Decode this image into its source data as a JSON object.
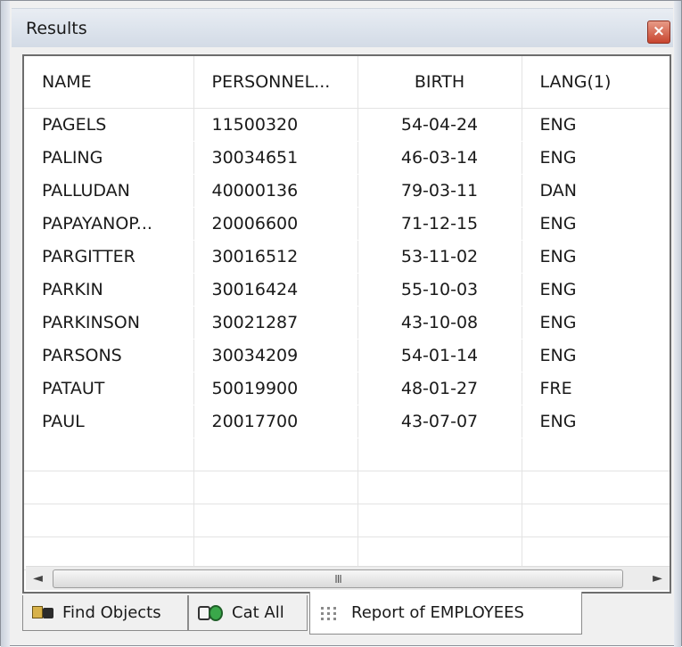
{
  "window": {
    "title": "Results",
    "close_glyph": "×"
  },
  "table": {
    "columns": [
      "NAME",
      "PERSONNEL...",
      "BIRTH",
      "LANG(1)"
    ],
    "rows": [
      [
        "PAGELS",
        "11500320",
        "54-04-24",
        "ENG"
      ],
      [
        "PALING",
        "30034651",
        "46-03-14",
        "ENG"
      ],
      [
        "PALLUDAN",
        "40000136",
        "79-03-11",
        "DAN"
      ],
      [
        "PAPAYANOP...",
        "20006600",
        "71-12-15",
        "ENG"
      ],
      [
        "PARGITTER",
        "30016512",
        "53-11-02",
        "ENG"
      ],
      [
        "PARKIN",
        "30016424",
        "55-10-03",
        "ENG"
      ],
      [
        "PARKINSON",
        "30021287",
        "43-10-08",
        "ENG"
      ],
      [
        "PARSONS",
        "30034209",
        "54-01-14",
        "ENG"
      ],
      [
        "PATAUT",
        "50019900",
        "48-01-27",
        "FRE"
      ],
      [
        "PAUL",
        "20017700",
        "43-07-07",
        "ENG"
      ]
    ],
    "empty_rows": 4
  },
  "scrollbar": {
    "left_arrow": "◄",
    "right_arrow": "►",
    "grip": "III"
  },
  "tabs": [
    {
      "label": "Find Objects",
      "icon": "find-objects-icon",
      "active": false
    },
    {
      "label": "Cat All",
      "icon": "cat-all-icon",
      "active": false
    },
    {
      "label": "Report of EMPLOYEES",
      "icon": "report-icon",
      "active": true
    }
  ]
}
